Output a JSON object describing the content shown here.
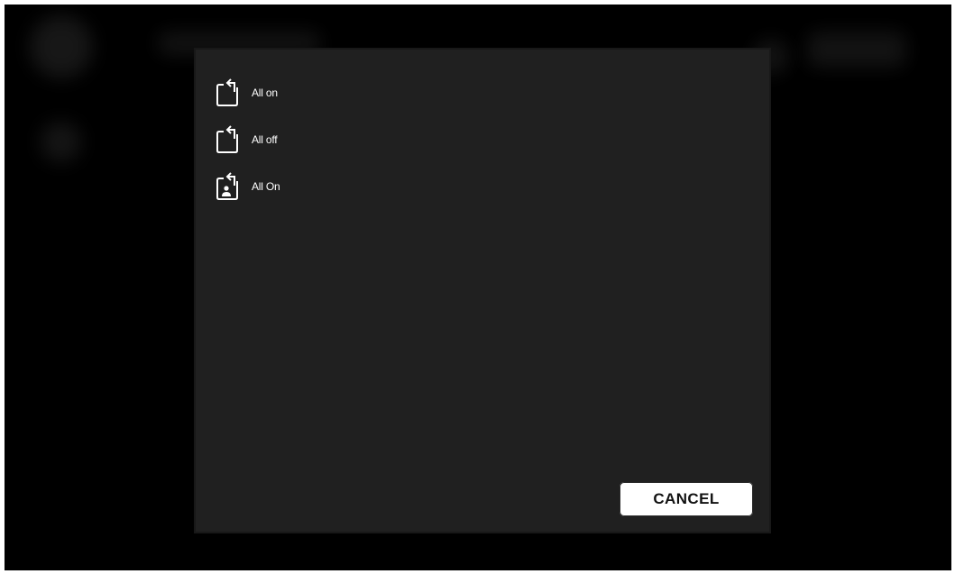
{
  "dialog": {
    "items": [
      {
        "label": "All on",
        "icon": "rotate-left-icon"
      },
      {
        "label": "All off",
        "icon": "rotate-left-icon"
      },
      {
        "label": "All On",
        "icon": "rotate-left-person-icon"
      }
    ],
    "cancel_label": "CANCEL"
  },
  "colors": {
    "background": "#000000",
    "dialog": "#202020",
    "button": "#ffffff",
    "text": "#ffffff"
  }
}
